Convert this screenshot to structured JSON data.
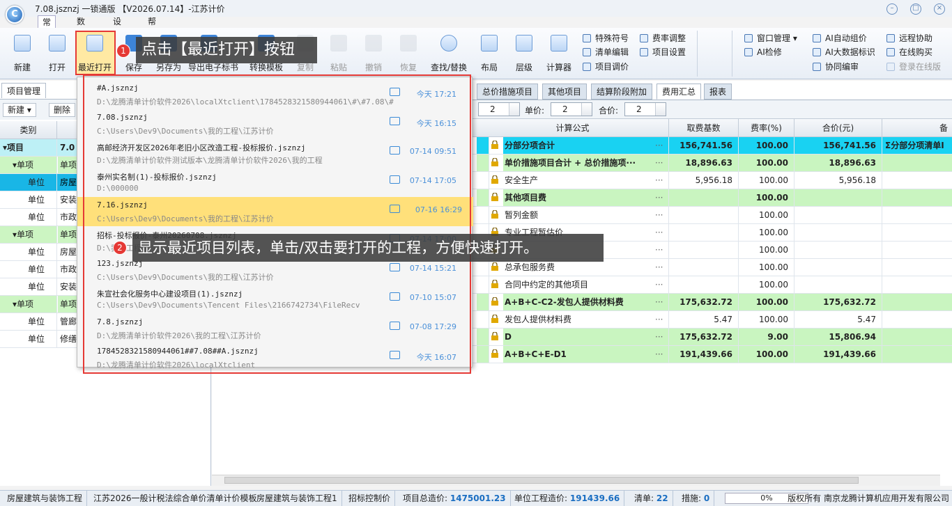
{
  "window": {
    "title": "7.08.jsznzj 一锁通版 【V2026.07.14】-江苏计价"
  },
  "menu_tabs": [
    "常用",
    "数据",
    "设置",
    "帮助"
  ],
  "ribbon": {
    "buttons": [
      {
        "label": "新建",
        "enabled": true
      },
      {
        "label": "打开",
        "enabled": true
      },
      {
        "label": "最近打开",
        "enabled": true
      },
      {
        "label": "保存",
        "enabled": true
      },
      {
        "label": "另存为",
        "enabled": true
      },
      {
        "label": "导出电子标书",
        "enabled": true
      },
      {
        "label": "转换模板",
        "enabled": true
      },
      {
        "label": "复制",
        "enabled": false
      },
      {
        "label": "粘贴",
        "enabled": false
      },
      {
        "label": "撤销",
        "enabled": false
      },
      {
        "label": "恢复",
        "enabled": false
      },
      {
        "label": "查找/替换",
        "enabled": true
      },
      {
        "label": "布局",
        "enabled": true
      },
      {
        "label": "层级",
        "enabled": true
      },
      {
        "label": "计算器",
        "enabled": true
      }
    ],
    "small_group1": [
      "特殊符号",
      "清单编辑",
      "项目调价",
      "费率调整",
      "项目设置"
    ],
    "small_group2": [
      "窗口管理",
      "AI检修",
      "AI自动组价",
      "AI大数据标识",
      "协同编审",
      "远程协助",
      "在线购买",
      "登录在线版"
    ]
  },
  "callouts": {
    "step1": "点击【最近打开】按钮",
    "step2": "显示最近项目列表，单击/双击要打开的工程，方便快速打开。",
    "badge1": "1",
    "badge2": "2"
  },
  "recent_files": [
    {
      "name": "#A.jsznzj",
      "path": "D:\\龙腾清单计价软件2026\\localXtclient\\1784528321580944061\\#\\#7.08\\#",
      "time": "今天 17:21"
    },
    {
      "name": "7.08.jsznzj",
      "path": "C:\\Users\\Dev9\\Documents\\我的工程\\江苏计价",
      "time": "今天 16:15"
    },
    {
      "name": "高邮经济开发区2026年老旧小区改造工程-投标报价.jsznzj",
      "path": "D:\\龙腾清单计价软件测试版本\\龙腾清单计价软件2026\\我的工程",
      "time": "07-14 09:51"
    },
    {
      "name": "泰州实名制(1)-投标报价.jsznzj",
      "path": "D:\\000000",
      "time": "07-14 17:05"
    },
    {
      "name": "7.16.jsznzj",
      "path": "C:\\Users\\Dev9\\Documents\\我的工程\\江苏计价",
      "time": "07-16 16:29"
    },
    {
      "name": "招标-投标报价-泰州20260708.jsznzj",
      "path": "D:\\我的工程",
      "time": "07-14 17:00"
    },
    {
      "name": "123.jsznzj",
      "path": "C:\\Users\\Dev9\\Documents\\我的工程\\江苏计价",
      "time": "07-14 15:21"
    },
    {
      "name": "朱宣社会化服务中心建设项目(1).jsznzj",
      "path": "C:\\Users\\Dev9\\Documents\\Tencent Files\\2166742734\\FileRecv",
      "time": "07-10 15:07"
    },
    {
      "name": "7.8.jsznzj",
      "path": "D:\\龙腾清单计价软件2026\\我的工程\\江苏计价",
      "time": "07-08 17:29"
    },
    {
      "name": "1784528321580944061##7.08##A.jsznzj",
      "path": "D:\\龙腾清单计价软件2026\\localXtclient",
      "time": "今天 16:07"
    }
  ],
  "left_panel": {
    "tab": "项目管理",
    "toolbar": [
      "新建",
      "删除"
    ],
    "header": "类别",
    "rows": [
      {
        "type": "项目",
        "name": "7.0"
      },
      {
        "type": "单项",
        "name": "单项"
      },
      {
        "type": "单位",
        "name": "房屋"
      },
      {
        "type": "单位",
        "name": "安装"
      },
      {
        "type": "单位",
        "name": "市政"
      },
      {
        "type": "单项",
        "name": "单项"
      },
      {
        "type": "单位",
        "name": "房屋"
      },
      {
        "type": "单位",
        "name": "市政"
      },
      {
        "type": "单位",
        "name": "安装"
      },
      {
        "type": "单项",
        "name": "单项"
      },
      {
        "type": "单位",
        "name": "管廊"
      },
      {
        "type": "单位",
        "name": "修缮"
      }
    ]
  },
  "right_panel": {
    "tabs": [
      "总价措施项目",
      "其他项目",
      "结算阶段附加",
      "费用汇总",
      "报表"
    ],
    "toolbar": {
      "spin1": "2",
      "unit_price_label": "单价:",
      "spin2": "2",
      "total_label": "合价:",
      "spin3": "2"
    },
    "columns": [
      "计算公式",
      "取费基数",
      "费率(%)",
      "合价(元)",
      "备"
    ],
    "rows": [
      {
        "name": "分部分项合计",
        "base": "156,741.56",
        "rate": "100.00",
        "total": "156,741.56",
        "note": "Σ分部分项清单I",
        "style": "cyan"
      },
      {
        "name": "单价措施项目合计 + 总价措施项···",
        "base": "18,896.63",
        "rate": "100.00",
        "total": "18,896.63",
        "note": "",
        "style": "grn"
      },
      {
        "name": "安全生产",
        "base": "5,956.18",
        "rate": "100.00",
        "total": "5,956.18",
        "note": "",
        "style": ""
      },
      {
        "name": "其他项目费",
        "base": "",
        "rate": "100.00",
        "total": "",
        "note": "",
        "style": "grn"
      },
      {
        "name": "暂列金额",
        "base": "",
        "rate": "100.00",
        "total": "",
        "note": "",
        "style": ""
      },
      {
        "name": "专业工程暂估价",
        "base": "",
        "rate": "100.00",
        "total": "",
        "note": "",
        "style": ""
      },
      {
        "name": "",
        "base": "",
        "rate": "100.00",
        "total": "",
        "note": "",
        "style": ""
      },
      {
        "name": "总承包服务费",
        "base": "",
        "rate": "100.00",
        "total": "",
        "note": "",
        "style": ""
      },
      {
        "name": "合同中约定的其他项目",
        "base": "",
        "rate": "100.00",
        "total": "",
        "note": "",
        "style": ""
      },
      {
        "name": "A+B+C-C2-发包人提供材料费",
        "base": "175,632.72",
        "rate": "100.00",
        "total": "175,632.72",
        "note": "",
        "style": "grn"
      },
      {
        "name": "发包人提供材料费",
        "base": "5.47",
        "rate": "100.00",
        "total": "5.47",
        "note": "",
        "style": ""
      },
      {
        "name": "D",
        "base": "175,632.72",
        "rate": "9.00",
        "total": "15,806.94",
        "note": "",
        "style": "grn"
      },
      {
        "name": "A+B+C+E-D1",
        "base": "191,439.66",
        "rate": "100.00",
        "total": "191,439.66",
        "note": "",
        "style": "grn"
      }
    ]
  },
  "status_bar": {
    "s1": "房屋建筑与装饰工程",
    "s2": "江苏2026一般计税法综合单价清单计价模板",
    "s3": "房屋建筑与装饰工程1",
    "s4": "招标控制价",
    "total_label": "项目总造价:",
    "total_value": "1475001.23",
    "unit_label": "单位工程造价:",
    "unit_value": "191439.66",
    "list_label": "清单:",
    "list_value": "22",
    "measure_label": "措施:",
    "measure_value": "0",
    "progress": "0%",
    "company": "版权所有 南京龙腾计算机应用开发有限公司"
  }
}
